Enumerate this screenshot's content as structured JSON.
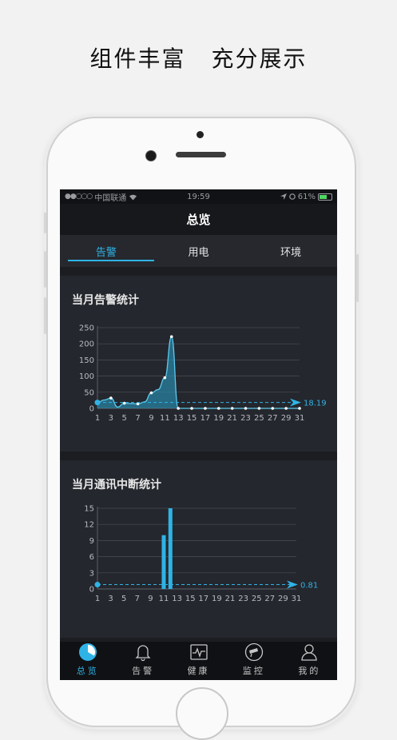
{
  "promo": {
    "part1": "组件丰富",
    "part2": "充分展示"
  },
  "status_bar": {
    "carrier": "中国联通",
    "time": "19:59",
    "battery_pct": "61%",
    "signal_dots": "●●○○○"
  },
  "nav": {
    "title": "总览"
  },
  "tabs": [
    {
      "label": "告警"
    },
    {
      "label": "用电"
    },
    {
      "label": "环境"
    }
  ],
  "cards": {
    "alarm": {
      "title": "当月告警统计"
    },
    "comm": {
      "title": "当月通讯中断统计"
    }
  },
  "colors": {
    "accent": "#2fb3e6",
    "bg": "#1b1d21",
    "card": "#24272d"
  },
  "chart_data": [
    {
      "type": "area",
      "title": "当月告警统计",
      "xlabel": "",
      "ylabel": "",
      "x_ticks": [
        "1",
        "3",
        "5",
        "7",
        "9",
        "11",
        "13",
        "15",
        "17",
        "19",
        "21",
        "23",
        "25",
        "27",
        "29",
        "31"
      ],
      "y_ticks": [
        "0",
        "50",
        "100",
        "150",
        "200",
        "250"
      ],
      "xlim": [
        1,
        31
      ],
      "ylim": [
        0,
        250
      ],
      "series": [
        {
          "x": [
            1,
            2,
            3,
            4,
            5,
            6,
            7,
            8,
            9,
            10,
            11,
            12,
            13,
            14,
            15,
            16,
            17,
            18,
            19,
            20,
            21,
            22,
            23,
            24,
            25,
            26,
            27,
            28,
            29,
            30,
            31
          ],
          "values": [
            18,
            26,
            32,
            4,
            16,
            15,
            14,
            20,
            48,
            58,
            95,
            222,
            0,
            0,
            0,
            0,
            0,
            0,
            0,
            0,
            0,
            0,
            0,
            0,
            0,
            0,
            0,
            0,
            0,
            0,
            0
          ]
        }
      ],
      "average": {
        "value": 18.19,
        "label": "18.19"
      },
      "grid": true
    },
    {
      "type": "bar",
      "title": "当月通讯中断统计",
      "xlabel": "",
      "ylabel": "",
      "x_ticks": [
        "1",
        "3",
        "5",
        "7",
        "9",
        "11",
        "13",
        "15",
        "17",
        "19",
        "21",
        "23",
        "25",
        "27",
        "29",
        "31"
      ],
      "y_ticks": [
        "0",
        "3",
        "6",
        "9",
        "12",
        "15"
      ],
      "xlim": [
        1,
        31
      ],
      "ylim": [
        0,
        15
      ],
      "series": [
        {
          "x": [
            11,
            12
          ],
          "values": [
            10,
            15
          ]
        }
      ],
      "average": {
        "value": 0.81,
        "label": "0.81"
      },
      "grid": true
    }
  ],
  "tabbar": [
    {
      "label": "总览",
      "icon": "clock-pie-icon"
    },
    {
      "label": "告警",
      "icon": "bell-icon"
    },
    {
      "label": "健康",
      "icon": "heartbeat-icon"
    },
    {
      "label": "监控",
      "icon": "camera-icon"
    },
    {
      "label": "我的",
      "icon": "user-icon"
    }
  ]
}
